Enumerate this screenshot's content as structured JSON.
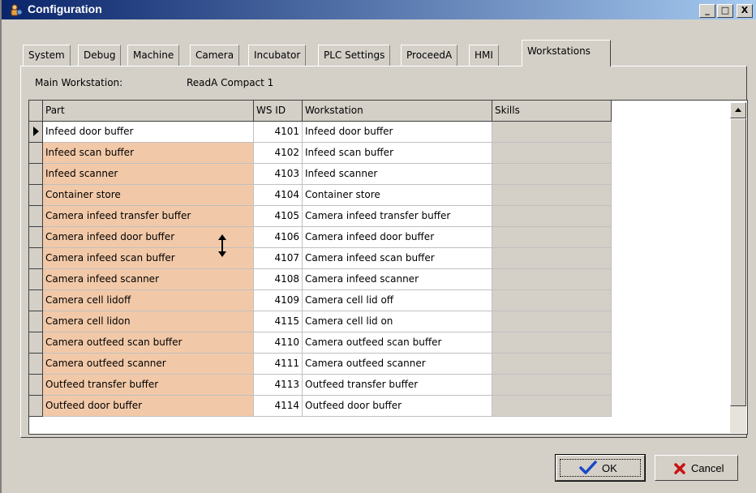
{
  "window": {
    "title": "Configuration",
    "controls": {
      "minimize": "_",
      "maximize": "□",
      "close": "X"
    }
  },
  "tabs": [
    "System",
    "Debug",
    "Machine",
    "Camera",
    "Incubator",
    "PLC Settings",
    "ProceedA",
    "HMI",
    "Workstations"
  ],
  "active_tab": "Workstations",
  "main_workstation": {
    "label": "Main Workstation:",
    "value": "ReadA Compact 1"
  },
  "grid": {
    "headers": {
      "part": "Part",
      "wsid": "WS ID",
      "workstation": "Workstation",
      "skills": "Skills"
    },
    "rows": [
      {
        "part": "Infeed door buffer",
        "wsid": "4101",
        "workstation": "Infeed door buffer",
        "skills": ""
      },
      {
        "part": "Infeed scan buffer",
        "wsid": "4102",
        "workstation": "Infeed scan buffer",
        "skills": ""
      },
      {
        "part": "Infeed scanner",
        "wsid": "4103",
        "workstation": "Infeed scanner",
        "skills": ""
      },
      {
        "part": "Container store",
        "wsid": "4104",
        "workstation": "Container store",
        "skills": ""
      },
      {
        "part": "Camera infeed transfer buffer",
        "wsid": "4105",
        "workstation": "Camera infeed transfer buffer",
        "skills": ""
      },
      {
        "part": "Camera infeed door buffer",
        "wsid": "4106",
        "workstation": "Camera infeed door buffer",
        "skills": ""
      },
      {
        "part": "Camera infeed scan buffer",
        "wsid": "4107",
        "workstation": "Camera infeed scan buffer",
        "skills": ""
      },
      {
        "part": "Camera infeed scanner",
        "wsid": "4108",
        "workstation": "Camera infeed scanner",
        "skills": ""
      },
      {
        "part": "Camera cell lidoff",
        "wsid": "4109",
        "workstation": "Camera cell lid off",
        "skills": ""
      },
      {
        "part": "Camera cell lidon",
        "wsid": "4115",
        "workstation": "Camera cell lid on",
        "skills": ""
      },
      {
        "part": "Camera outfeed scan buffer",
        "wsid": "4110",
        "workstation": "Camera outfeed scan buffer",
        "skills": ""
      },
      {
        "part": "Camera outfeed scanner",
        "wsid": "4111",
        "workstation": "Camera outfeed scanner",
        "skills": ""
      },
      {
        "part": "Outfeed transfer buffer",
        "wsid": "4113",
        "workstation": "Outfeed transfer buffer",
        "skills": ""
      },
      {
        "part": "Outfeed door buffer",
        "wsid": "4114",
        "workstation": "Outfeed door buffer",
        "skills": ""
      }
    ]
  },
  "buttons": {
    "ok": "OK",
    "cancel": "Cancel"
  },
  "colors": {
    "part_cell_bg": "#f2c9a8",
    "title_start": "#0a246a",
    "title_end": "#a6caf0",
    "dialog_bg": "#d4d0c8"
  },
  "icons": {
    "app": "configuration-app-icon",
    "ok": "checkmark-icon",
    "cancel": "red-x-icon",
    "row_pointer": "row-indicator-arrow-icon",
    "cursor": "resize-vertical-cursor-icon"
  }
}
